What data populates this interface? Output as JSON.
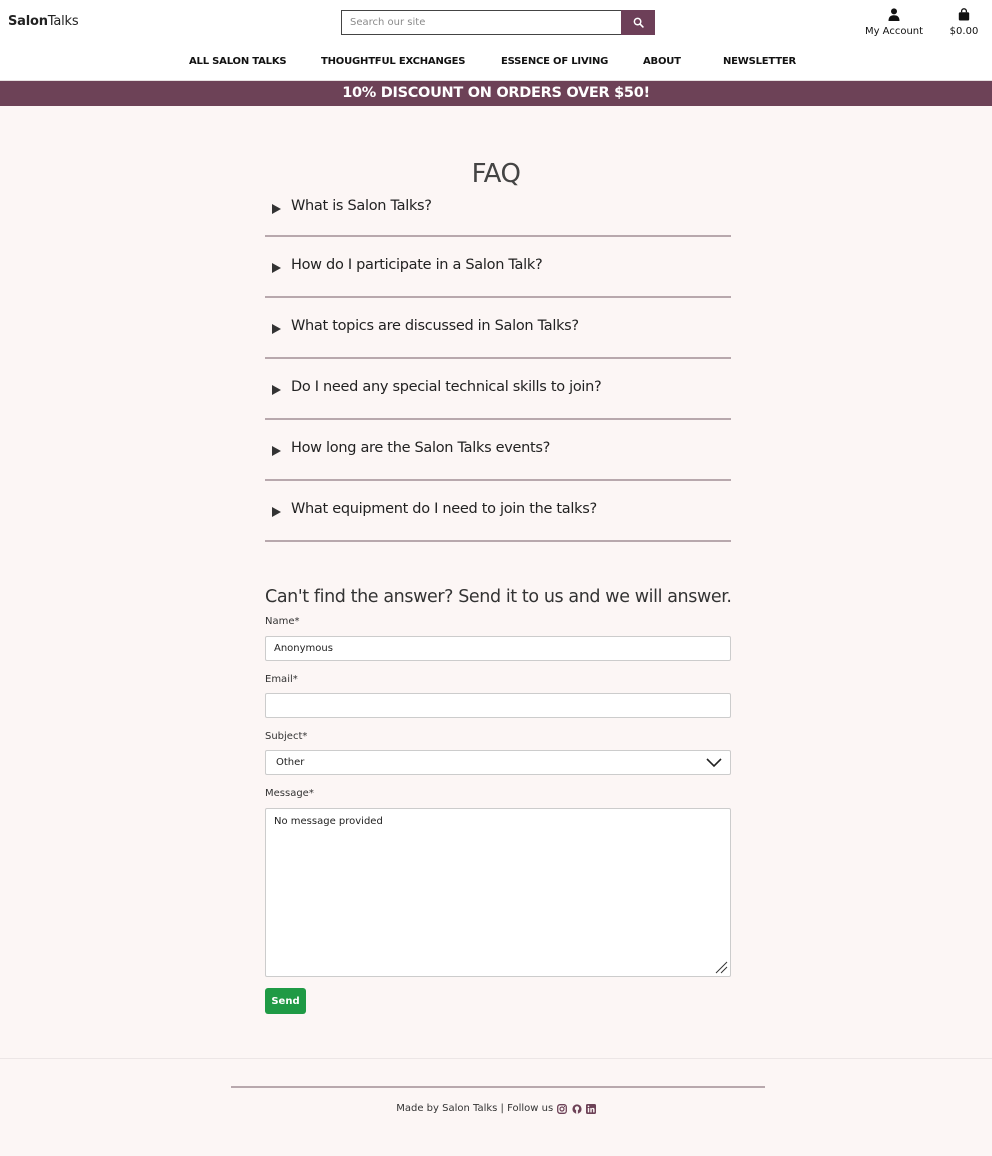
{
  "header": {
    "logo_bold": "Salon",
    "logo_rest": "Talks",
    "search_placeholder": "Search our site",
    "account_label": "My Account",
    "cart_total": "$0.00"
  },
  "nav": {
    "items": [
      "ALL SALON TALKS",
      "THOUGHTFUL EXCHANGES",
      "ESSENCE OF LIVING",
      "ABOUT",
      "NEWSLETTER"
    ]
  },
  "banner": {
    "text": "10% DISCOUNT ON ORDERS OVER $50!"
  },
  "faq": {
    "title": "FAQ",
    "questions": [
      "What is Salon Talks?",
      "How do I participate in a Salon Talk?",
      "What topics are discussed in Salon Talks?",
      "Do I need any special technical skills to join?",
      "How long are the Salon Talks events?",
      "What equipment do I need to join the talks?"
    ]
  },
  "contact_form": {
    "title": "Can't find the answer? Send it to us and we will answer.",
    "name_label": "Name*",
    "name_value": "Anonymous",
    "email_label": "Email*",
    "email_value": "",
    "subject_label": "Subject*",
    "subject_value": "Other",
    "message_label": "Message*",
    "message_value": "No message provided",
    "send_label": "Send"
  },
  "footer": {
    "text": "Made by Salon Talks | Follow us",
    "icons": [
      "instagram-icon",
      "github-icon",
      "linkedin-icon"
    ]
  },
  "colors": {
    "brand": "#6d4257",
    "send_button": "#1f9a45",
    "background": "#fcf6f5"
  }
}
